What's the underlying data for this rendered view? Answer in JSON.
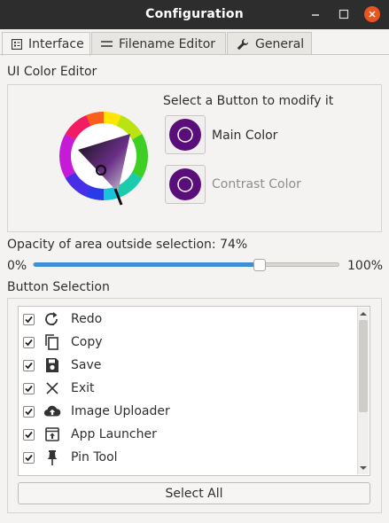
{
  "window": {
    "title": "Configuration"
  },
  "tabs": [
    {
      "label": "Interface",
      "icon": "interface-icon",
      "active": true
    },
    {
      "label": "Filename Editor",
      "icon": "lines-icon",
      "active": false
    },
    {
      "label": "General",
      "icon": "wrench-icon",
      "active": false
    }
  ],
  "color_editor": {
    "heading": "UI Color Editor",
    "instruction": "Select a Button to modify it",
    "main_label": "Main Color",
    "contrast_label": "Contrast Color",
    "main_color": "#5a0e7a",
    "contrast_color": "#5a0e7a"
  },
  "opacity": {
    "label": "Opacity of area outside selection: 74%",
    "min_label": "0%",
    "max_label": "100%",
    "value": 0.74
  },
  "button_selection": {
    "heading": "Button Selection",
    "items": [
      {
        "label": "Redo",
        "icon": "redo-icon",
        "checked": true
      },
      {
        "label": "Copy",
        "icon": "copy-icon",
        "checked": true
      },
      {
        "label": "Save",
        "icon": "save-icon",
        "checked": true
      },
      {
        "label": "Exit",
        "icon": "close-icon",
        "checked": true
      },
      {
        "label": "Image Uploader",
        "icon": "cloud-upload-icon",
        "checked": true
      },
      {
        "label": "App Launcher",
        "icon": "app-launcher-icon",
        "checked": true
      },
      {
        "label": "Pin Tool",
        "icon": "pin-icon",
        "checked": true
      }
    ],
    "select_all_label": "Select All"
  }
}
